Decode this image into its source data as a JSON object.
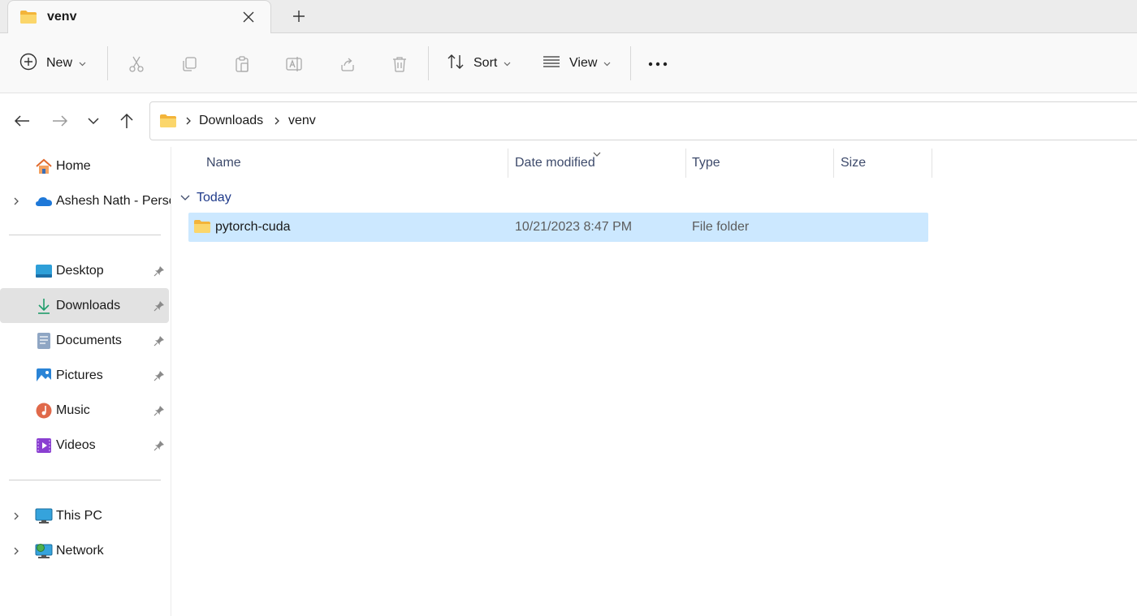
{
  "window": {
    "tab_title": "venv",
    "icons": {
      "tab": "folder-icon",
      "close": "close-icon",
      "new_tab": "plus-icon"
    }
  },
  "toolbar": {
    "new_label": "New",
    "sort_label": "Sort",
    "view_label": "View",
    "icon_buttons": [
      "cut-icon",
      "copy-icon",
      "paste-icon",
      "rename-icon",
      "share-icon",
      "delete-icon"
    ],
    "more": "more-icon"
  },
  "navigation": {
    "buttons": [
      "back-icon",
      "forward-icon",
      "recent-dropdown-icon",
      "up-icon"
    ],
    "breadcrumbs": [
      "Downloads",
      "venv"
    ]
  },
  "sidebar": {
    "items": [
      {
        "label": "Home",
        "icon": "home-icon",
        "expandable": false,
        "pinned": false,
        "selected": false
      },
      {
        "label": "Ashesh Nath - Personal",
        "icon": "onedrive-icon",
        "expandable": true,
        "pinned": false,
        "selected": false
      },
      {
        "label": "Desktop",
        "icon": "desktop-icon",
        "expandable": false,
        "pinned": true,
        "selected": false
      },
      {
        "label": "Downloads",
        "icon": "downloads-icon",
        "expandable": false,
        "pinned": true,
        "selected": true
      },
      {
        "label": "Documents",
        "icon": "documents-icon",
        "expandable": false,
        "pinned": true,
        "selected": false
      },
      {
        "label": "Pictures",
        "icon": "pictures-icon",
        "expandable": false,
        "pinned": true,
        "selected": false
      },
      {
        "label": "Music",
        "icon": "music-icon",
        "expandable": false,
        "pinned": true,
        "selected": false
      },
      {
        "label": "Videos",
        "icon": "videos-icon",
        "expandable": false,
        "pinned": true,
        "selected": false
      },
      {
        "label": "This PC",
        "icon": "this-pc-icon",
        "expandable": true,
        "pinned": false,
        "selected": false
      },
      {
        "label": "Network",
        "icon": "network-icon",
        "expandable": true,
        "pinned": false,
        "selected": false
      }
    ]
  },
  "file_list": {
    "columns": [
      "Name",
      "Date modified",
      "Type",
      "Size"
    ],
    "sorted_by": "Date modified",
    "groups": [
      {
        "label": "Today",
        "rows": [
          {
            "name": "pytorch-cuda",
            "date_modified": "10/21/2023 8:47 PM",
            "type": "File folder",
            "size": "",
            "icon": "folder-icon",
            "selected": true
          }
        ]
      }
    ]
  },
  "colors": {
    "accent": "#0067c0",
    "selection": "#cce8ff",
    "folder": "#f8c94c",
    "group_header": "#1f3a8a",
    "sidebar_selected": "#e2e2e2"
  }
}
